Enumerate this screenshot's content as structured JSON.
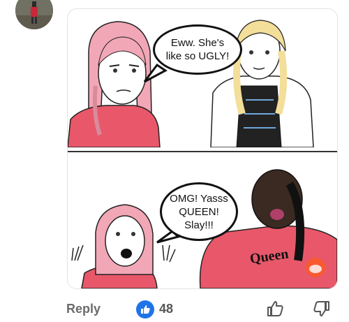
{
  "comment": {
    "meme": {
      "top_panel": {
        "speech": "Eww. She's like so UGLY!"
      },
      "bottom_panel": {
        "speech": "OMG! Yasss QUEEN! Slay!!!",
        "shirt_text": "Queen"
      }
    },
    "actions": {
      "reply_label": "Reply",
      "like_count": "48"
    }
  },
  "colors": {
    "like_blue": "#1f74e8",
    "shirt_pink": "#e8586a"
  }
}
